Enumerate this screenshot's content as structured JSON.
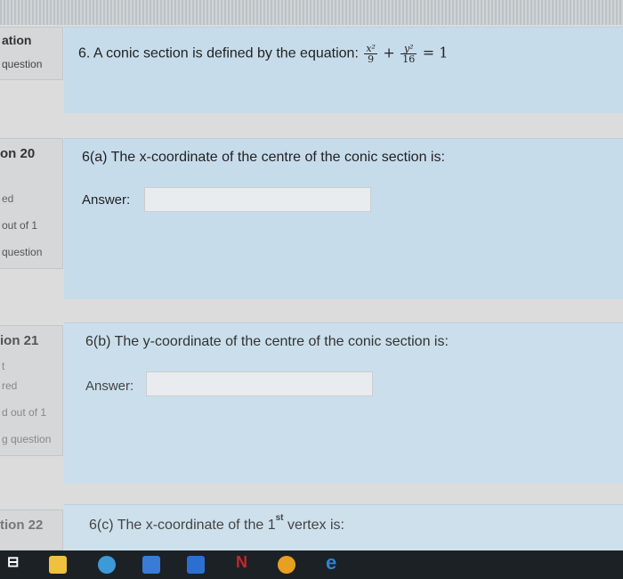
{
  "header": {
    "info_title": "ation",
    "info_sub": "question"
  },
  "question_main": {
    "text": "6. A conic section is defined by the equation:",
    "eq": {
      "x_num": "x²",
      "x_den": "9",
      "plus": "+",
      "y_num": "y²",
      "y_den": "16",
      "rhs": "= 1"
    }
  },
  "q20": {
    "num": "on 20",
    "status": "ed",
    "marks": "out of 1",
    "flag": "question",
    "text": "6(a) The x-coordinate of the centre of the conic section is:",
    "answer_label": "Answer:",
    "answer_value": ""
  },
  "q21": {
    "num": "ion 21",
    "mark_t": "t",
    "status": "red",
    "marks": "d out of 1",
    "flag": "g question",
    "text": "6(b) The y-coordinate of the centre of the conic section is:",
    "answer_label": "Answer:",
    "answer_value": ""
  },
  "q22": {
    "num": "tion 22",
    "text_pre": "6(c) The x-coordinate of the 1",
    "text_sup": "st",
    "text_post": " vertex is:"
  },
  "taskbar": {
    "icons": [
      "task-view-icon",
      "file-explorer-icon",
      "chat-icon",
      "store-icon",
      "outlook-icon",
      "netflix-icon",
      "chrome-icon",
      "edge-icon"
    ],
    "colors": {
      "bg": "#1c2126",
      "explorer": "#f0c040",
      "chat": "#3c9ad8",
      "store": "#3a7bd5",
      "outlook": "#2b6fd1",
      "netflix": "#c62828",
      "chrome": "#e8a020",
      "edge": "#2b84d8"
    }
  }
}
